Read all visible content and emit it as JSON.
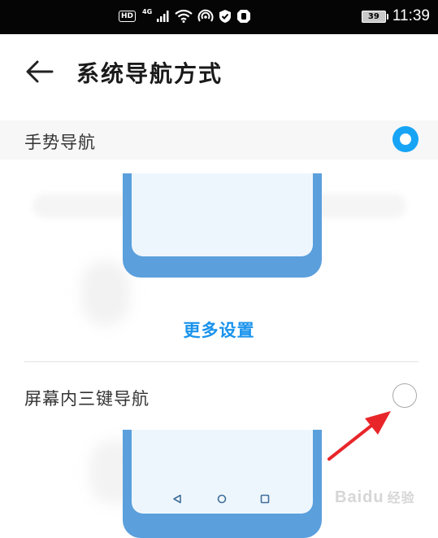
{
  "status_bar": {
    "hd": "HD",
    "network": "4G",
    "battery": "39",
    "time": "11:39"
  },
  "header": {
    "title": "系统导航方式"
  },
  "options": [
    {
      "label": "手势导航",
      "selected": true
    },
    {
      "label": "屏幕内三键导航",
      "selected": false
    }
  ],
  "more_settings": "更多设置",
  "watermark": {
    "brand": "Bai",
    "paw": "du",
    "suffix": "经验"
  },
  "colors": {
    "accent": "#17a4f5",
    "link": "#1a93ec",
    "phone_frame": "#5b9fdc",
    "phone_screen": "#eef6fd",
    "annotation_arrow": "#e8262a"
  },
  "icons": {
    "back": "left-arrow-icon",
    "nav_back": "triangle-back-icon",
    "nav_home": "circle-home-icon",
    "nav_recent": "square-recent-icon"
  }
}
